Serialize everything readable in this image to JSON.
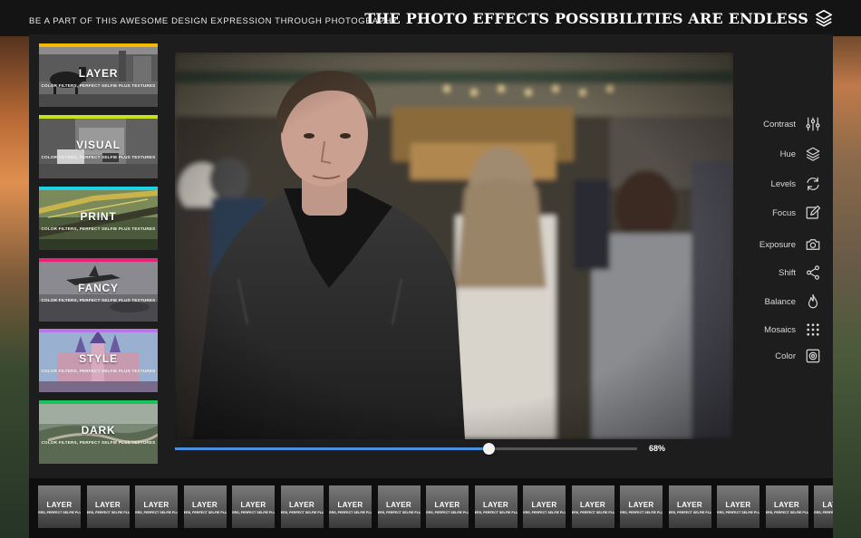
{
  "header": {
    "tagline": "BE A PART OF THIS AWESOME DESIGN EXPRESSION THROUGH PHOTOGRAPHY",
    "headline": "THE PHOTO EFFECTS POSSIBILITIES ARE ENDLESS",
    "headline_icon": "layers-icon"
  },
  "filters": [
    {
      "title": "LAYER",
      "subtitle": "COLOR FILTERS, PERFECT SELFIE PLUS TEXTURES",
      "accent": "#f5b800"
    },
    {
      "title": "VISUAL",
      "subtitle": "COLOR FILTERS, PERFECT SELFIE PLUS TEXTURES",
      "accent": "#c6e21c"
    },
    {
      "title": "PRINT",
      "subtitle": "COLOR FILTERS, PERFECT SELFIE PLUS TEXTURES",
      "accent": "#1fd1e6"
    },
    {
      "title": "FANCY",
      "subtitle": "COLOR FILTERS, PERFECT SELFIE PLUS TEXTURES",
      "accent": "#e8237a"
    },
    {
      "title": "STYLE",
      "subtitle": "COLOR FILTERS, PERFECT SELFIE PLUS TEXTURES",
      "accent": "#b874e8"
    },
    {
      "title": "DARK",
      "subtitle": "COLOR FILTERS, PERFECT SELFIE PLUS TEXTURES",
      "accent": "#16c45a"
    }
  ],
  "slider": {
    "value": 0.68,
    "label": "68%",
    "accent": "#4a90e2"
  },
  "tools": [
    {
      "label": "Contrast",
      "icon": "sliders-icon"
    },
    {
      "label": "Hue",
      "icon": "layers-icon"
    },
    {
      "label": "Levels",
      "icon": "refresh-icon"
    },
    {
      "label": "Focus",
      "icon": "edit-icon"
    },
    {
      "label": "Exposure",
      "icon": "camera-icon"
    },
    {
      "label": "Shift",
      "icon": "share-icon"
    },
    {
      "label": "Balance",
      "icon": "flame-icon"
    },
    {
      "label": "Mosaics",
      "icon": "grid-icon"
    },
    {
      "label": "Color",
      "icon": "lens-icon"
    }
  ],
  "strip": {
    "items": [
      {
        "title": "LAYER",
        "subtitle": "TERS, PERFECT SELFIE PLUS"
      },
      {
        "title": "LAYER",
        "subtitle": "TERS, PERFECT SELFIE PLUS"
      },
      {
        "title": "LAYER",
        "subtitle": "TERS, PERFECT SELFIE PLUS"
      },
      {
        "title": "LAYER",
        "subtitle": "TERS, PERFECT SELFIE PLUS"
      },
      {
        "title": "LAYER",
        "subtitle": "TERS, PERFECT SELFIE PLUS"
      },
      {
        "title": "LAYER",
        "subtitle": "TERS, PERFECT SELFIE PLUS"
      },
      {
        "title": "LAYER",
        "subtitle": "TERS, PERFECT SELFIE PLUS"
      },
      {
        "title": "LAYER",
        "subtitle": "TERS, PERFECT SELFIE PLUS"
      },
      {
        "title": "LAYER",
        "subtitle": "TERS, PERFECT SELFIE PLUS"
      },
      {
        "title": "LAYER",
        "subtitle": "TERS, PERFECT SELFIE PLUS"
      },
      {
        "title": "LAYER",
        "subtitle": "TERS, PERFECT SELFIE PLUS"
      },
      {
        "title": "LAYER",
        "subtitle": "TERS, PERFECT SELFIE PLUS"
      },
      {
        "title": "LAYER",
        "subtitle": "TERS, PERFECT SELFIE PLUS"
      },
      {
        "title": "LAYER",
        "subtitle": "TERS, PERFECT SELFIE PLUS"
      },
      {
        "title": "LAYER",
        "subtitle": "TERS, PERFECT SELFIE PLUS"
      },
      {
        "title": "LAYER",
        "subtitle": "TERS, PERFECT SELFIE PLUS"
      },
      {
        "title": "LAYER",
        "subtitle": "TERS, PERFECT SELFIE PLUS"
      }
    ]
  }
}
